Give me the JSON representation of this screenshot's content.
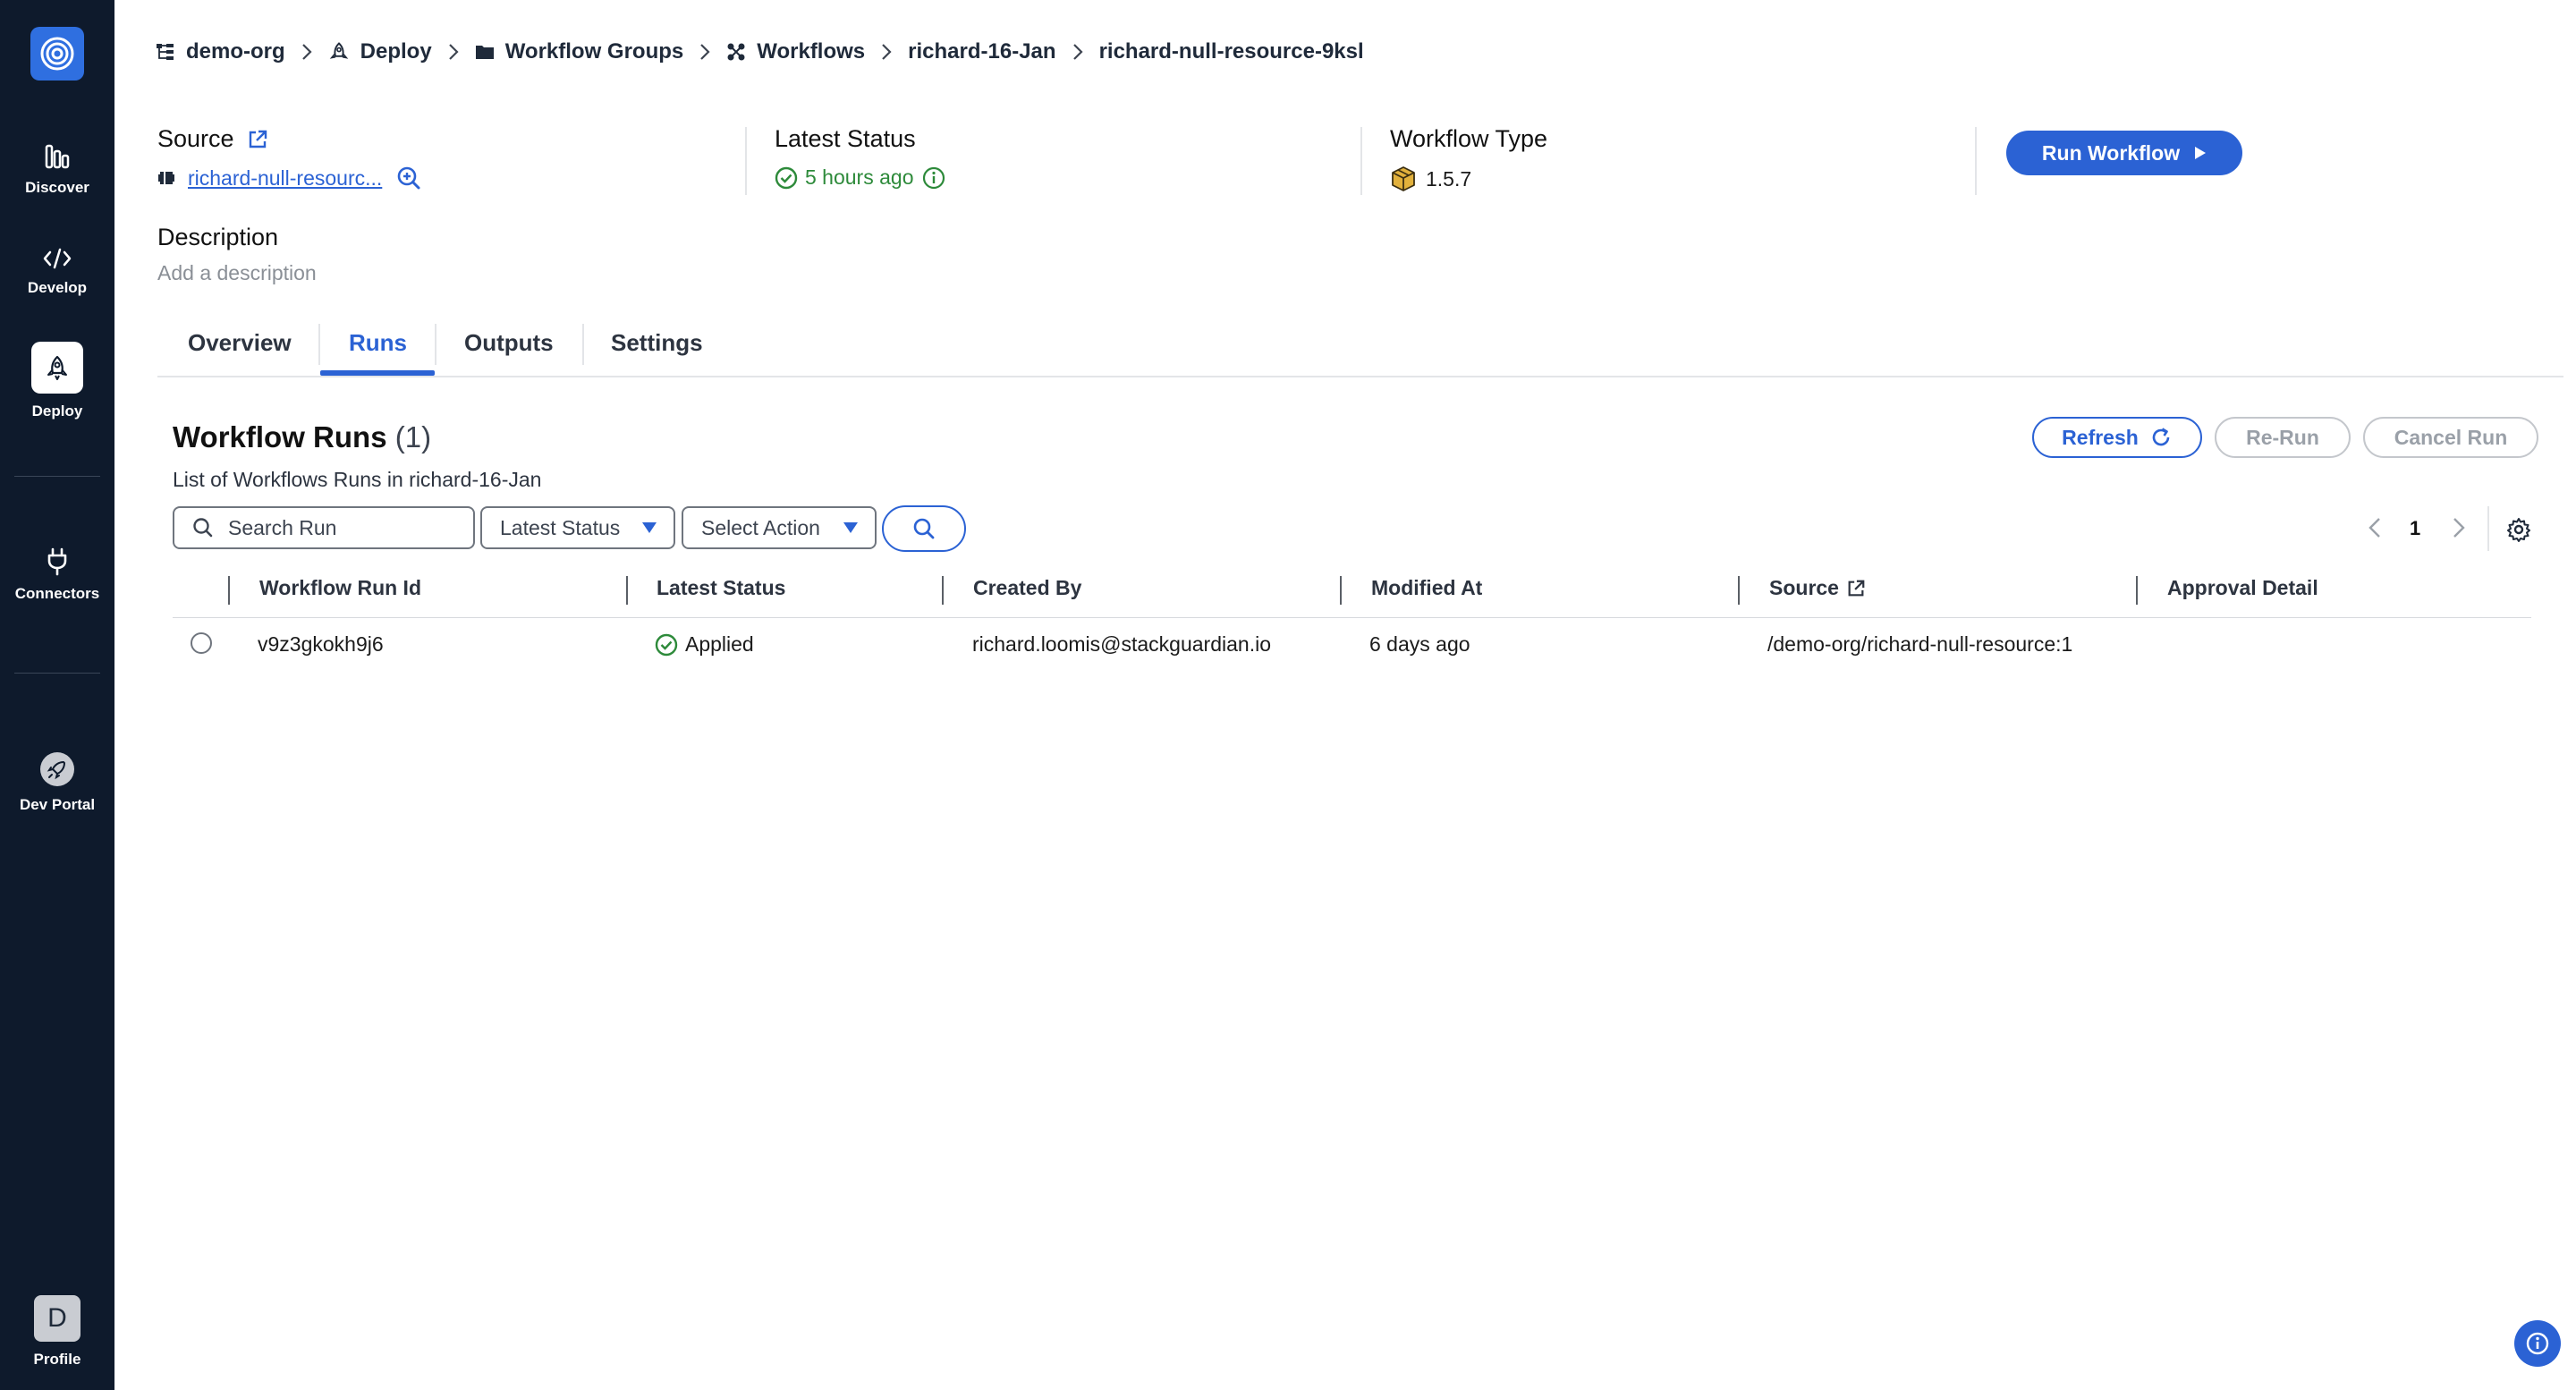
{
  "sidebar": {
    "items": [
      {
        "label": "Discover",
        "icon": "bar-chart-icon"
      },
      {
        "label": "Develop",
        "icon": "code-icon"
      },
      {
        "label": "Deploy",
        "icon": "rocket-icon"
      },
      {
        "label": "Connectors",
        "icon": "plug-icon"
      },
      {
        "label": "Dev Portal",
        "icon": "rocket-circle-icon"
      }
    ],
    "profile": {
      "initial": "D",
      "label": "Profile"
    }
  },
  "breadcrumb": [
    {
      "label": "demo-org",
      "icon": "org-tree-icon"
    },
    {
      "label": "Deploy",
      "icon": "rocket-icon"
    },
    {
      "label": "Workflow Groups",
      "icon": "folder-icon"
    },
    {
      "label": "Workflows",
      "icon": "workflows-icon"
    },
    {
      "label": "richard-16-Jan"
    },
    {
      "label": "richard-null-resource-9ksl"
    }
  ],
  "info": {
    "source_label": "Source",
    "source_value": "richard-null-resourc...",
    "latest_status_label": "Latest Status",
    "latest_status_value": "5 hours ago",
    "workflow_type_label": "Workflow Type",
    "workflow_type_value": "1.5.7",
    "run_workflow_label": "Run Workflow"
  },
  "description": {
    "title": "Description",
    "placeholder": "Add a description"
  },
  "tabs": [
    {
      "label": "Overview",
      "active": false
    },
    {
      "label": "Runs",
      "active": true
    },
    {
      "label": "Outputs",
      "active": false
    },
    {
      "label": "Settings",
      "active": false
    }
  ],
  "runs": {
    "title": "Workflow Runs",
    "count": "(1)",
    "subtitle": "List of Workflows Runs in richard-16-Jan",
    "refresh_label": "Refresh",
    "rerun_label": "Re-Run",
    "cancel_label": "Cancel Run",
    "search_placeholder": "Search Run",
    "status_filter": "Latest Status",
    "action_filter": "Select Action",
    "page": "1",
    "columns": [
      "Workflow Run Id",
      "Latest Status",
      "Created By",
      "Modified At",
      "Source",
      "Approval Detail"
    ],
    "rows": [
      {
        "run_id": "v9z3gkokh9j6",
        "status": "Applied",
        "created_by": "richard.loomis@stackguardian.io",
        "modified_at": "6 days ago",
        "source": "/demo-org/richard-null-resource:1",
        "approval": ""
      }
    ]
  },
  "colors": {
    "sidebar_bg": "#0e1a2c",
    "accent": "#2b62d4",
    "success": "#2d8a3a"
  }
}
